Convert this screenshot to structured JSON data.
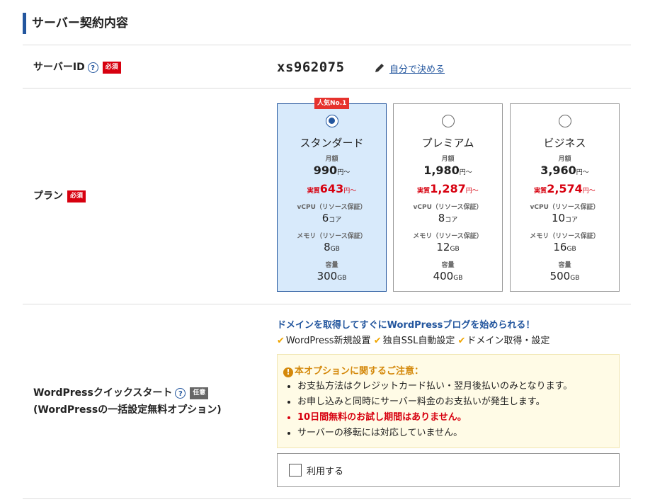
{
  "section": {
    "title": "サーバー契約内容"
  },
  "server_id": {
    "label": "サーバーID",
    "help": "?",
    "required": "必須",
    "value": "xs962075",
    "link": "自分で決める",
    "link_icon": "pencil-icon"
  },
  "plan": {
    "label": "プラン",
    "required": "必須",
    "cards": [
      {
        "name": "スタンダード",
        "badge": "人気No.1",
        "selected": true,
        "monthly_label": "月額",
        "price": "990",
        "price_unit": "円〜",
        "real_label": "実質",
        "real_price": "643",
        "real_unit": "円〜",
        "vcpu_label": "vCPU（リソース保証）",
        "vcpu": "6",
        "vcpu_unit": "コア",
        "mem_label": "メモリ（リソース保証）",
        "mem": "8",
        "mem_unit": "GB",
        "disk_label": "容量",
        "disk": "300",
        "disk_unit": "GB"
      },
      {
        "name": "プレミアム",
        "selected": false,
        "monthly_label": "月額",
        "price": "1,980",
        "price_unit": "円〜",
        "real_label": "実質",
        "real_price": "1,287",
        "real_unit": "円〜",
        "vcpu_label": "vCPU（リソース保証）",
        "vcpu": "8",
        "vcpu_unit": "コア",
        "mem_label": "メモリ（リソース保証）",
        "mem": "12",
        "mem_unit": "GB",
        "disk_label": "容量",
        "disk": "400",
        "disk_unit": "GB"
      },
      {
        "name": "ビジネス",
        "selected": false,
        "monthly_label": "月額",
        "price": "3,960",
        "price_unit": "円〜",
        "real_label": "実質",
        "real_price": "2,574",
        "real_unit": "円〜",
        "vcpu_label": "vCPU（リソース保証）",
        "vcpu": "10",
        "vcpu_unit": "コア",
        "mem_label": "メモリ（リソース保証）",
        "mem": "16",
        "mem_unit": "GB",
        "disk_label": "容量",
        "disk": "500",
        "disk_unit": "GB"
      }
    ]
  },
  "wordpress": {
    "label_line1": "WordPressクイックスタート",
    "label_line2": "(WordPressの一括設定無料オプション)",
    "help": "?",
    "optional": "任意",
    "headline": "ドメインを取得してすぐにWordPressブログを始められる！",
    "features": [
      "WordPress新規設置",
      "独自SSL自動設定",
      "ドメイン取得・設定"
    ],
    "notice_title": "本オプションに関するご注意：",
    "notice_items": [
      "お支払方法はクレジットカード払い・翌月後払いのみとなります。",
      "お申し込みと同時にサーバー料金のお支払いが発生します。",
      "10日間無料のお試し期間はありません。",
      "サーバーの移転には対応していません。"
    ],
    "use_label": "利用する",
    "use_checked": false
  },
  "colors": {
    "accent": "#23569e",
    "required": "#d7000f",
    "selected_bg": "#d8eafb",
    "check": "#f0a500"
  }
}
